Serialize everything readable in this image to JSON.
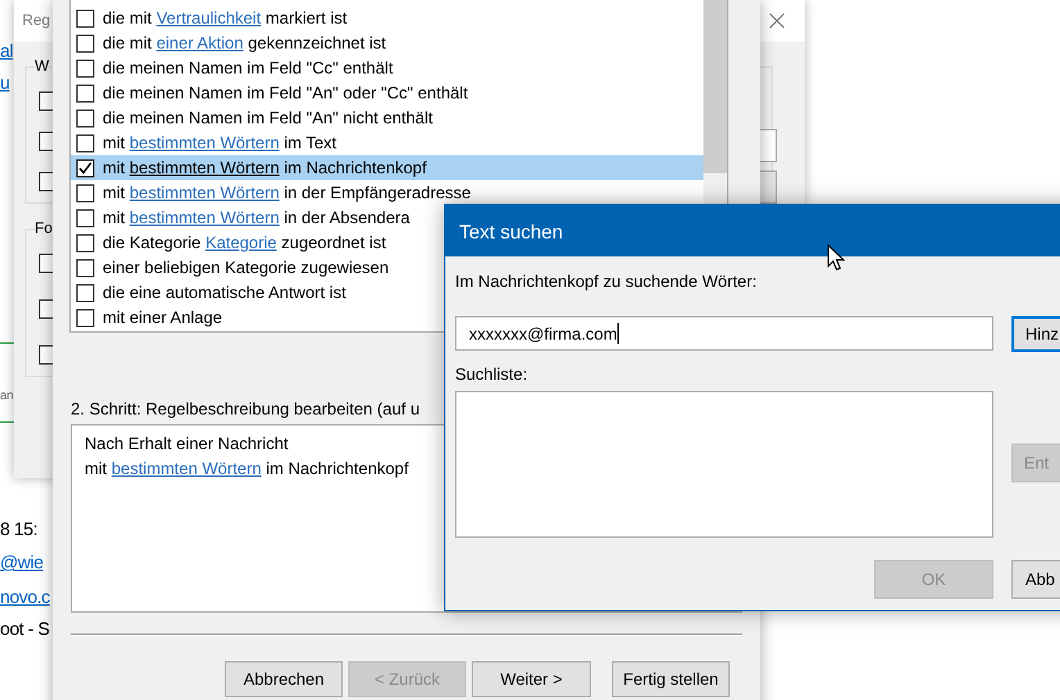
{
  "background_app": {
    "fragments": [
      {
        "text": "al",
        "kind": "link"
      },
      {
        "text": "u",
        "kind": "link"
      },
      {
        "text": "an",
        "kind": "muted"
      },
      {
        "text": "8 15:",
        "kind": "plain"
      },
      {
        "text": "@wie",
        "kind": "link"
      },
      {
        "text": "novo.c",
        "kind": "link"
      },
      {
        "text": "oot - S",
        "kind": "plain"
      }
    ]
  },
  "rules_window": {
    "title": "Reg",
    "groups": [
      {
        "label": "W",
        "checkboxes": [
          {
            "checked": false
          },
          {
            "checked": false
          },
          {
            "checked": false
          }
        ]
      },
      {
        "label": "Fo",
        "checkboxes": [
          {
            "checked": false
          },
          {
            "checked": false
          },
          {
            "checked": false
          }
        ]
      }
    ]
  },
  "wizard": {
    "conditions": [
      {
        "before": "die mit ",
        "link": "Vertraulichkeit",
        "after": " markiert ist",
        "checked": false,
        "selected": false
      },
      {
        "before": "die mit ",
        "link": "einer Aktion",
        "after": " gekennzeichnet ist",
        "checked": false,
        "selected": false
      },
      {
        "before": "die meinen Namen im Feld \"Cc\" enthält",
        "checked": false,
        "selected": false
      },
      {
        "before": "die meinen Namen im Feld \"An\" oder \"Cc\" enthält",
        "checked": false,
        "selected": false
      },
      {
        "before": "die meinen Namen im Feld \"An\" nicht enthält",
        "checked": false,
        "selected": false
      },
      {
        "before": "mit ",
        "link": "bestimmten Wörtern",
        "after": " im Text",
        "checked": false,
        "selected": false
      },
      {
        "before": "mit ",
        "link": "bestimmten Wörtern",
        "after": " im Nachrichtenkopf",
        "checked": true,
        "selected": true
      },
      {
        "before": "mit ",
        "link": "bestimmten Wörtern",
        "after": " in der Empfängeradresse",
        "checked": false,
        "selected": false
      },
      {
        "before": "mit ",
        "link": "bestimmten Wörtern",
        "after": " in der Absendera",
        "checked": false,
        "selected": false
      },
      {
        "before": "die Kategorie ",
        "link": "Kategorie",
        "after": " zugeordnet ist",
        "checked": false,
        "selected": false
      },
      {
        "before": "einer beliebigen Kategorie zugewiesen",
        "checked": false,
        "selected": false
      },
      {
        "before": "die eine automatische Antwort ist",
        "checked": false,
        "selected": false
      },
      {
        "before": "mit einer Anlage",
        "checked": false,
        "selected": false
      }
    ],
    "step2_label": "2. Schritt: Regelbeschreibung bearbeiten (auf u",
    "description": [
      {
        "before": "Nach Erhalt einer Nachricht"
      },
      {
        "before": "mit ",
        "link": "bestimmten Wörtern",
        "after": " im Nachrichtenkopf"
      }
    ],
    "buttons": [
      {
        "label": "Abbrechen",
        "disabled": false
      },
      {
        "label": "< Zurück",
        "disabled": true
      },
      {
        "label": "Weiter >",
        "disabled": false
      },
      {
        "label": "Fertig stellen",
        "disabled": false
      }
    ]
  },
  "text_dialog": {
    "title": "Text suchen",
    "prompt": "Im Nachrichtenkopf zu suchende Wörter:",
    "value": "xxxxxxx@firma.com",
    "add_button": {
      "label": "Hinz",
      "disabled": false
    },
    "list_label": "Suchliste:",
    "remove_button": {
      "label": "Ent",
      "disabled": true
    },
    "buttons": [
      {
        "label": "OK",
        "disabled": true
      },
      {
        "label": "Abb",
        "disabled": false
      }
    ]
  }
}
